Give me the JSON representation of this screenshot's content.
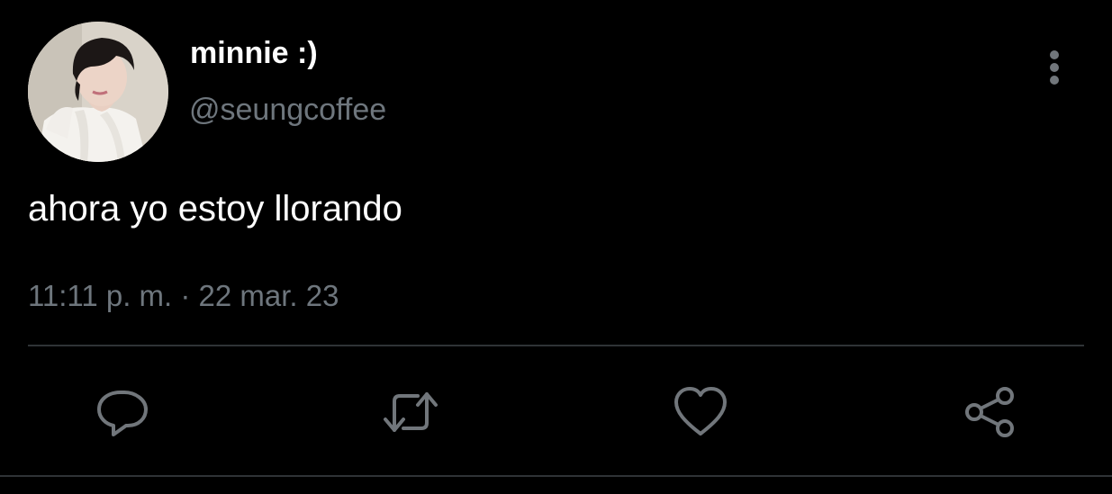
{
  "tweet": {
    "author": {
      "display_name": "minnie :)",
      "handle": "@seungcoffee",
      "avatar_icon": "profile-photo"
    },
    "text": "ahora yo estoy llorando",
    "timestamp": "11:11 p. m. · 22 mar. 23",
    "more_icon": "more-vertical-icon"
  },
  "actions": [
    {
      "name": "reply",
      "icon": "reply-icon"
    },
    {
      "name": "retweet",
      "icon": "retweet-icon"
    },
    {
      "name": "like",
      "icon": "heart-icon"
    },
    {
      "name": "share",
      "icon": "share-icon"
    }
  ],
  "colors": {
    "background": "#000000",
    "text_primary": "#ffffff",
    "text_secondary": "#6e767d",
    "icon": "#71767b",
    "divider": "#2f3336"
  }
}
